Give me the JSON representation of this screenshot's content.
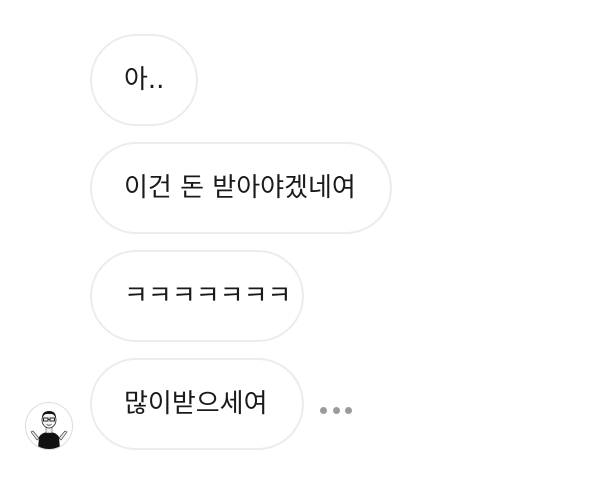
{
  "chat": {
    "messages": [
      {
        "text": "아.."
      },
      {
        "text": "이건 돈 받아야겠네여"
      },
      {
        "text": "ㅋㅋㅋㅋㅋㅋㅋ"
      },
      {
        "text": "많이받으세여"
      }
    ],
    "sender_avatar_icon": "person-avatar-icon",
    "more_options_icon": "ellipsis-icon"
  }
}
